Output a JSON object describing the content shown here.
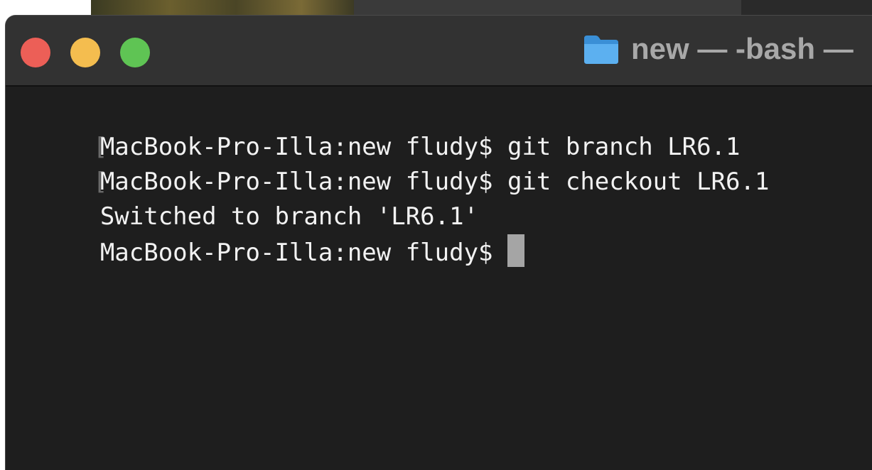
{
  "window": {
    "title": "new — -bash —",
    "folder_icon": "folder-icon",
    "traffic_lights": {
      "close": "#ec5f57",
      "minimize": "#f4bd4f",
      "zoom": "#5fc454"
    }
  },
  "terminal": {
    "marker": "[",
    "lines": [
      {
        "text": "MacBook-Pro-Illa:new fludy$ git branch LR6.1"
      },
      {
        "text": "MacBook-Pro-Illa:new fludy$ git checkout LR6.1"
      },
      {
        "text": "Switched to branch 'LR6.1'"
      },
      {
        "text": "MacBook-Pro-Illa:new fludy$"
      }
    ]
  }
}
